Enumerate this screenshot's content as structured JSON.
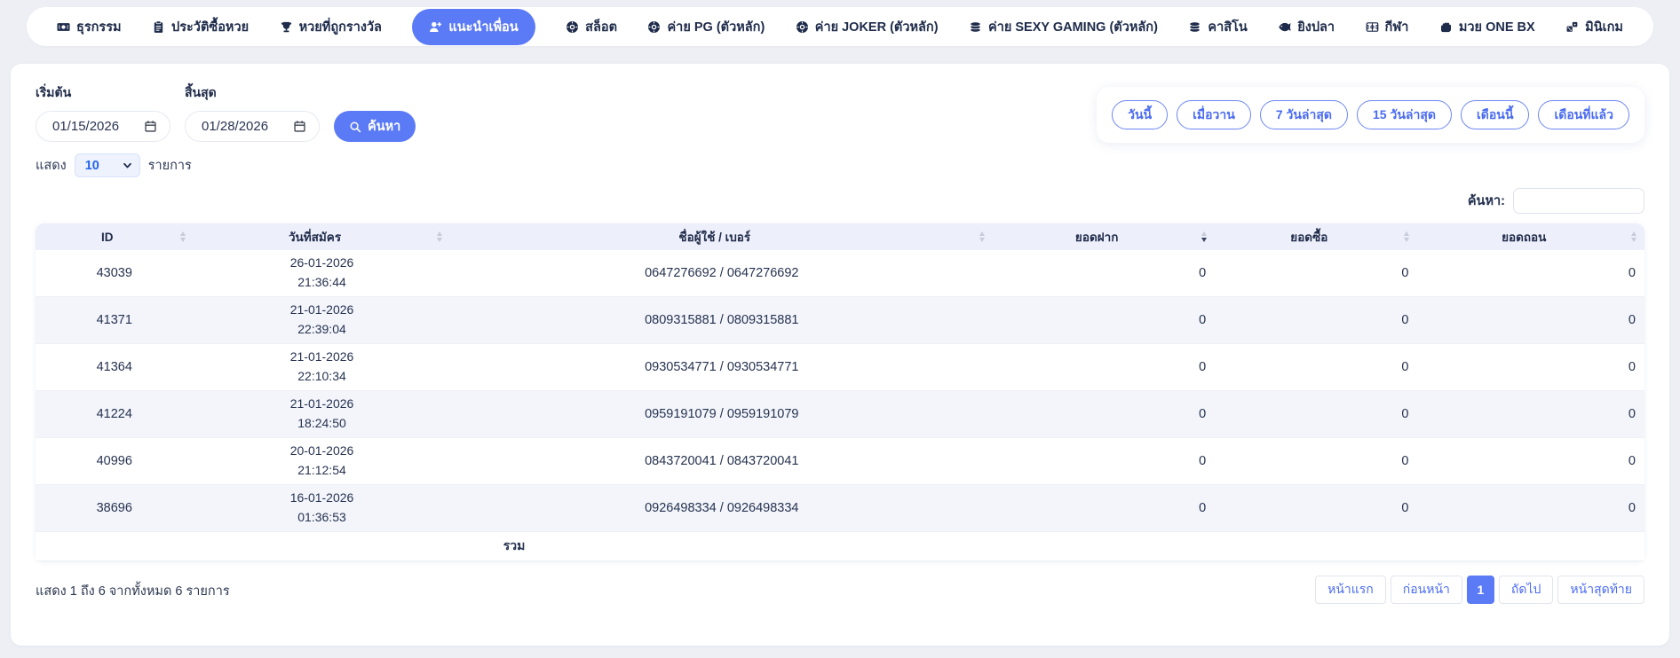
{
  "theme": {
    "accent": "#5b7af5",
    "header_bg": "#edeffa",
    "stripe_bg": "#f3f5fb",
    "page_bg": "#edeff4"
  },
  "navbar": {
    "tabs": [
      {
        "key": "transactions",
        "label": "ธุรกรรม",
        "icon": "money-icon",
        "active": false
      },
      {
        "key": "lottery-history",
        "label": "ประวัติซื้อหวย",
        "icon": "clipboard-icon",
        "active": false
      },
      {
        "key": "winning-lottery",
        "label": "หวยที่ถูกรางวัล",
        "icon": "trophy-icon",
        "active": false
      },
      {
        "key": "refer-friend",
        "label": "แนะนำเพื่อน",
        "icon": "user-plus-icon",
        "active": true
      },
      {
        "key": "slots",
        "label": "สล็อต",
        "icon": "chip-icon",
        "active": false
      },
      {
        "key": "pg-camp",
        "label": "ค่าย PG (ตัวหลัก)",
        "icon": "chip-icon",
        "active": false
      },
      {
        "key": "joker-camp",
        "label": "ค่าย JOKER (ตัวหลัก)",
        "icon": "chip-icon",
        "active": false
      },
      {
        "key": "sexy-gaming-camp",
        "label": "ค่าย SEXY GAMING (ตัวหลัก)",
        "icon": "coins-icon",
        "active": false
      },
      {
        "key": "casino",
        "label": "คาสิโน",
        "icon": "coins-icon",
        "active": false
      },
      {
        "key": "fish-shooting",
        "label": "ยิงปลา",
        "icon": "fish-icon",
        "active": false
      },
      {
        "key": "sports",
        "label": "กีฬา",
        "icon": "sports-icon",
        "active": false
      },
      {
        "key": "boxing",
        "label": "มวย ONE BX",
        "icon": "fist-icon",
        "active": false
      },
      {
        "key": "minigames",
        "label": "มินิเกม",
        "icon": "dice-icon",
        "active": false
      }
    ]
  },
  "filters": {
    "start_label": "เริ่มต้น",
    "start_value": "01/15/2026",
    "end_label": "สิ้นสุด",
    "end_value": "01/28/2026",
    "search_button": "ค้นหา",
    "quick_ranges": [
      {
        "key": "today",
        "label": "วันนี้"
      },
      {
        "key": "yesterday",
        "label": "เมื่อวาน"
      },
      {
        "key": "last-7-days",
        "label": "7 วันล่าสุด"
      },
      {
        "key": "last-15-days",
        "label": "15 วันล่าสุด"
      },
      {
        "key": "this-month",
        "label": "เดือนนี้"
      },
      {
        "key": "last-month",
        "label": "เดือนที่แล้ว"
      }
    ]
  },
  "page_size": {
    "prefix": "แสดง",
    "value": "10",
    "suffix": "รายการ"
  },
  "table_search": {
    "label": "ค้นหา:",
    "value": ""
  },
  "table": {
    "columns": [
      {
        "key": "id",
        "label": "ID",
        "sort": "none"
      },
      {
        "key": "date",
        "label": "วันที่สมัคร",
        "sort": "none"
      },
      {
        "key": "user",
        "label": "ชื่อผู้ใช้ / เบอร์",
        "sort": "none"
      },
      {
        "key": "deposit",
        "label": "ยอดฝาก",
        "sort": "desc"
      },
      {
        "key": "buy",
        "label": "ยอดซื้อ",
        "sort": "none"
      },
      {
        "key": "withdraw",
        "label": "ยอดถอน",
        "sort": "none"
      }
    ],
    "rows": [
      {
        "id": "43039",
        "date": "26-01-2026",
        "time": "21:36:44",
        "user": "0647276692 / 0647276692",
        "deposit": "0",
        "buy": "0",
        "withdraw": "0"
      },
      {
        "id": "41371",
        "date": "21-01-2026",
        "time": "22:39:04",
        "user": "0809315881 / 0809315881",
        "deposit": "0",
        "buy": "0",
        "withdraw": "0"
      },
      {
        "id": "41364",
        "date": "21-01-2026",
        "time": "22:10:34",
        "user": "0930534771 / 0930534771",
        "deposit": "0",
        "buy": "0",
        "withdraw": "0"
      },
      {
        "id": "41224",
        "date": "21-01-2026",
        "time": "18:24:50",
        "user": "0959191079 / 0959191079",
        "deposit": "0",
        "buy": "0",
        "withdraw": "0"
      },
      {
        "id": "40996",
        "date": "20-01-2026",
        "time": "21:12:54",
        "user": "0843720041 / 0843720041",
        "deposit": "0",
        "buy": "0",
        "withdraw": "0"
      },
      {
        "id": "38696",
        "date": "16-01-2026",
        "time": "01:36:53",
        "user": "0926498334 / 0926498334",
        "deposit": "0",
        "buy": "0",
        "withdraw": "0"
      }
    ],
    "total_label": "รวม"
  },
  "footer": {
    "info": "แสดง 1 ถึง 6 จากทั้งหมด 6 รายการ",
    "pagination": {
      "first_label": "หน้าแรก",
      "prev_label": "ก่อนหน้า",
      "pages": [
        {
          "label": "1",
          "active": true
        }
      ],
      "next_label": "ถัดไป",
      "last_label": "หน้าสุดท้าย"
    }
  }
}
